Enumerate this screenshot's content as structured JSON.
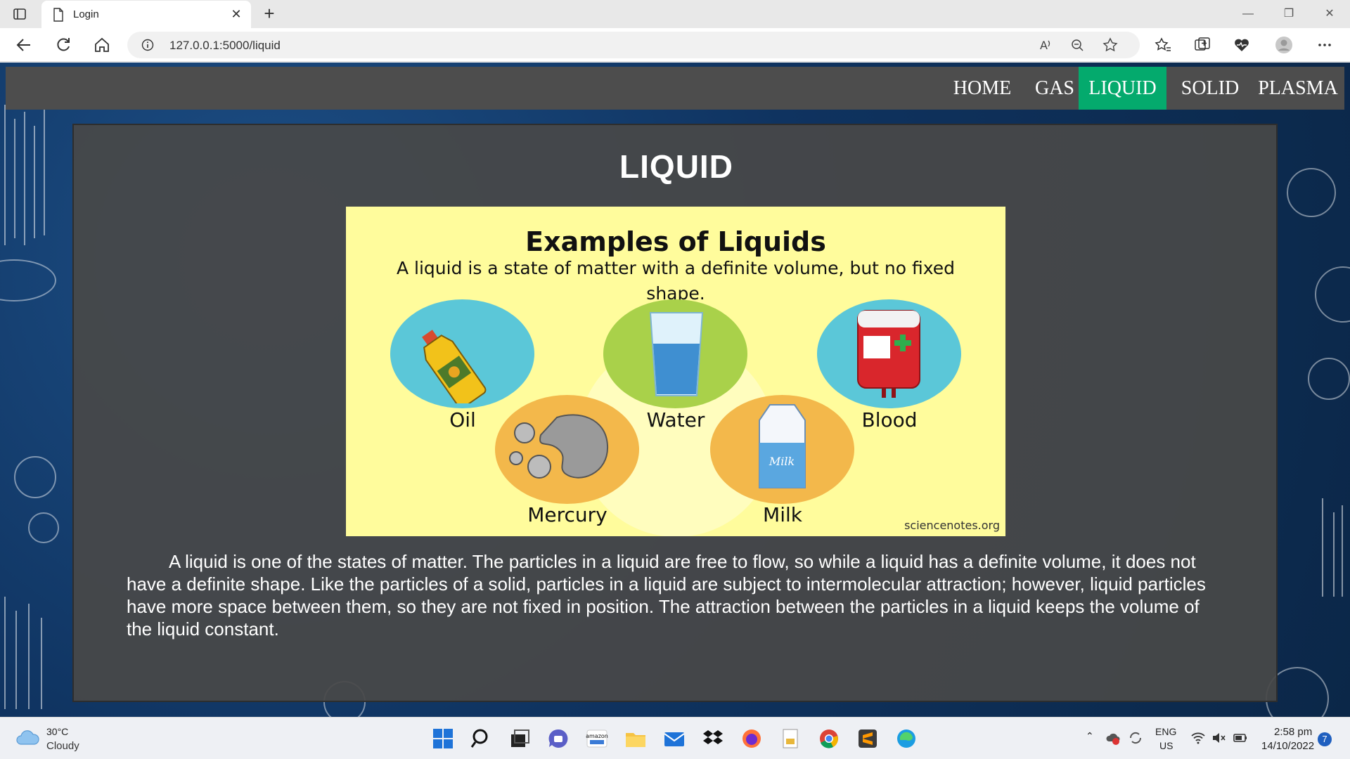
{
  "browser": {
    "tab_title": "Login",
    "url": "127.0.0.1:5000/liquid"
  },
  "nav": {
    "items": [
      "HOME",
      "GAS",
      "LIQUID",
      "SOLID",
      "PLASMA"
    ],
    "active": "LIQUID",
    "active_color": "#04aa6d",
    "bar_color": "#4d4d4d"
  },
  "content": {
    "title": "LIQUID",
    "paragraph": "A liquid is one of the states of matter. The particles in a liquid are free to flow, so while a liquid has a definite volume, it does not have a definite shape. Like the particles of a solid, particles in a liquid are subject to intermolecular attraction; however, liquid particles have more space between them, so they are not fixed in position. The attraction between the particles in a liquid keeps the volume of the liquid constant."
  },
  "figure": {
    "title": "Examples of Liquids",
    "subtitle": "A liquid is a state of matter with a definite volume, but no fixed shape.",
    "labels": [
      "Oil",
      "Water",
      "Blood",
      "Mercury",
      "Milk"
    ],
    "credit": "sciencenotes.org",
    "background_color": "#fffc9c"
  },
  "taskbar": {
    "temperature": "30°C",
    "weather": "Cloudy",
    "language": "ENG",
    "region": "US",
    "time": "2:58 pm",
    "date": "14/10/2022",
    "notification_count": "7"
  }
}
